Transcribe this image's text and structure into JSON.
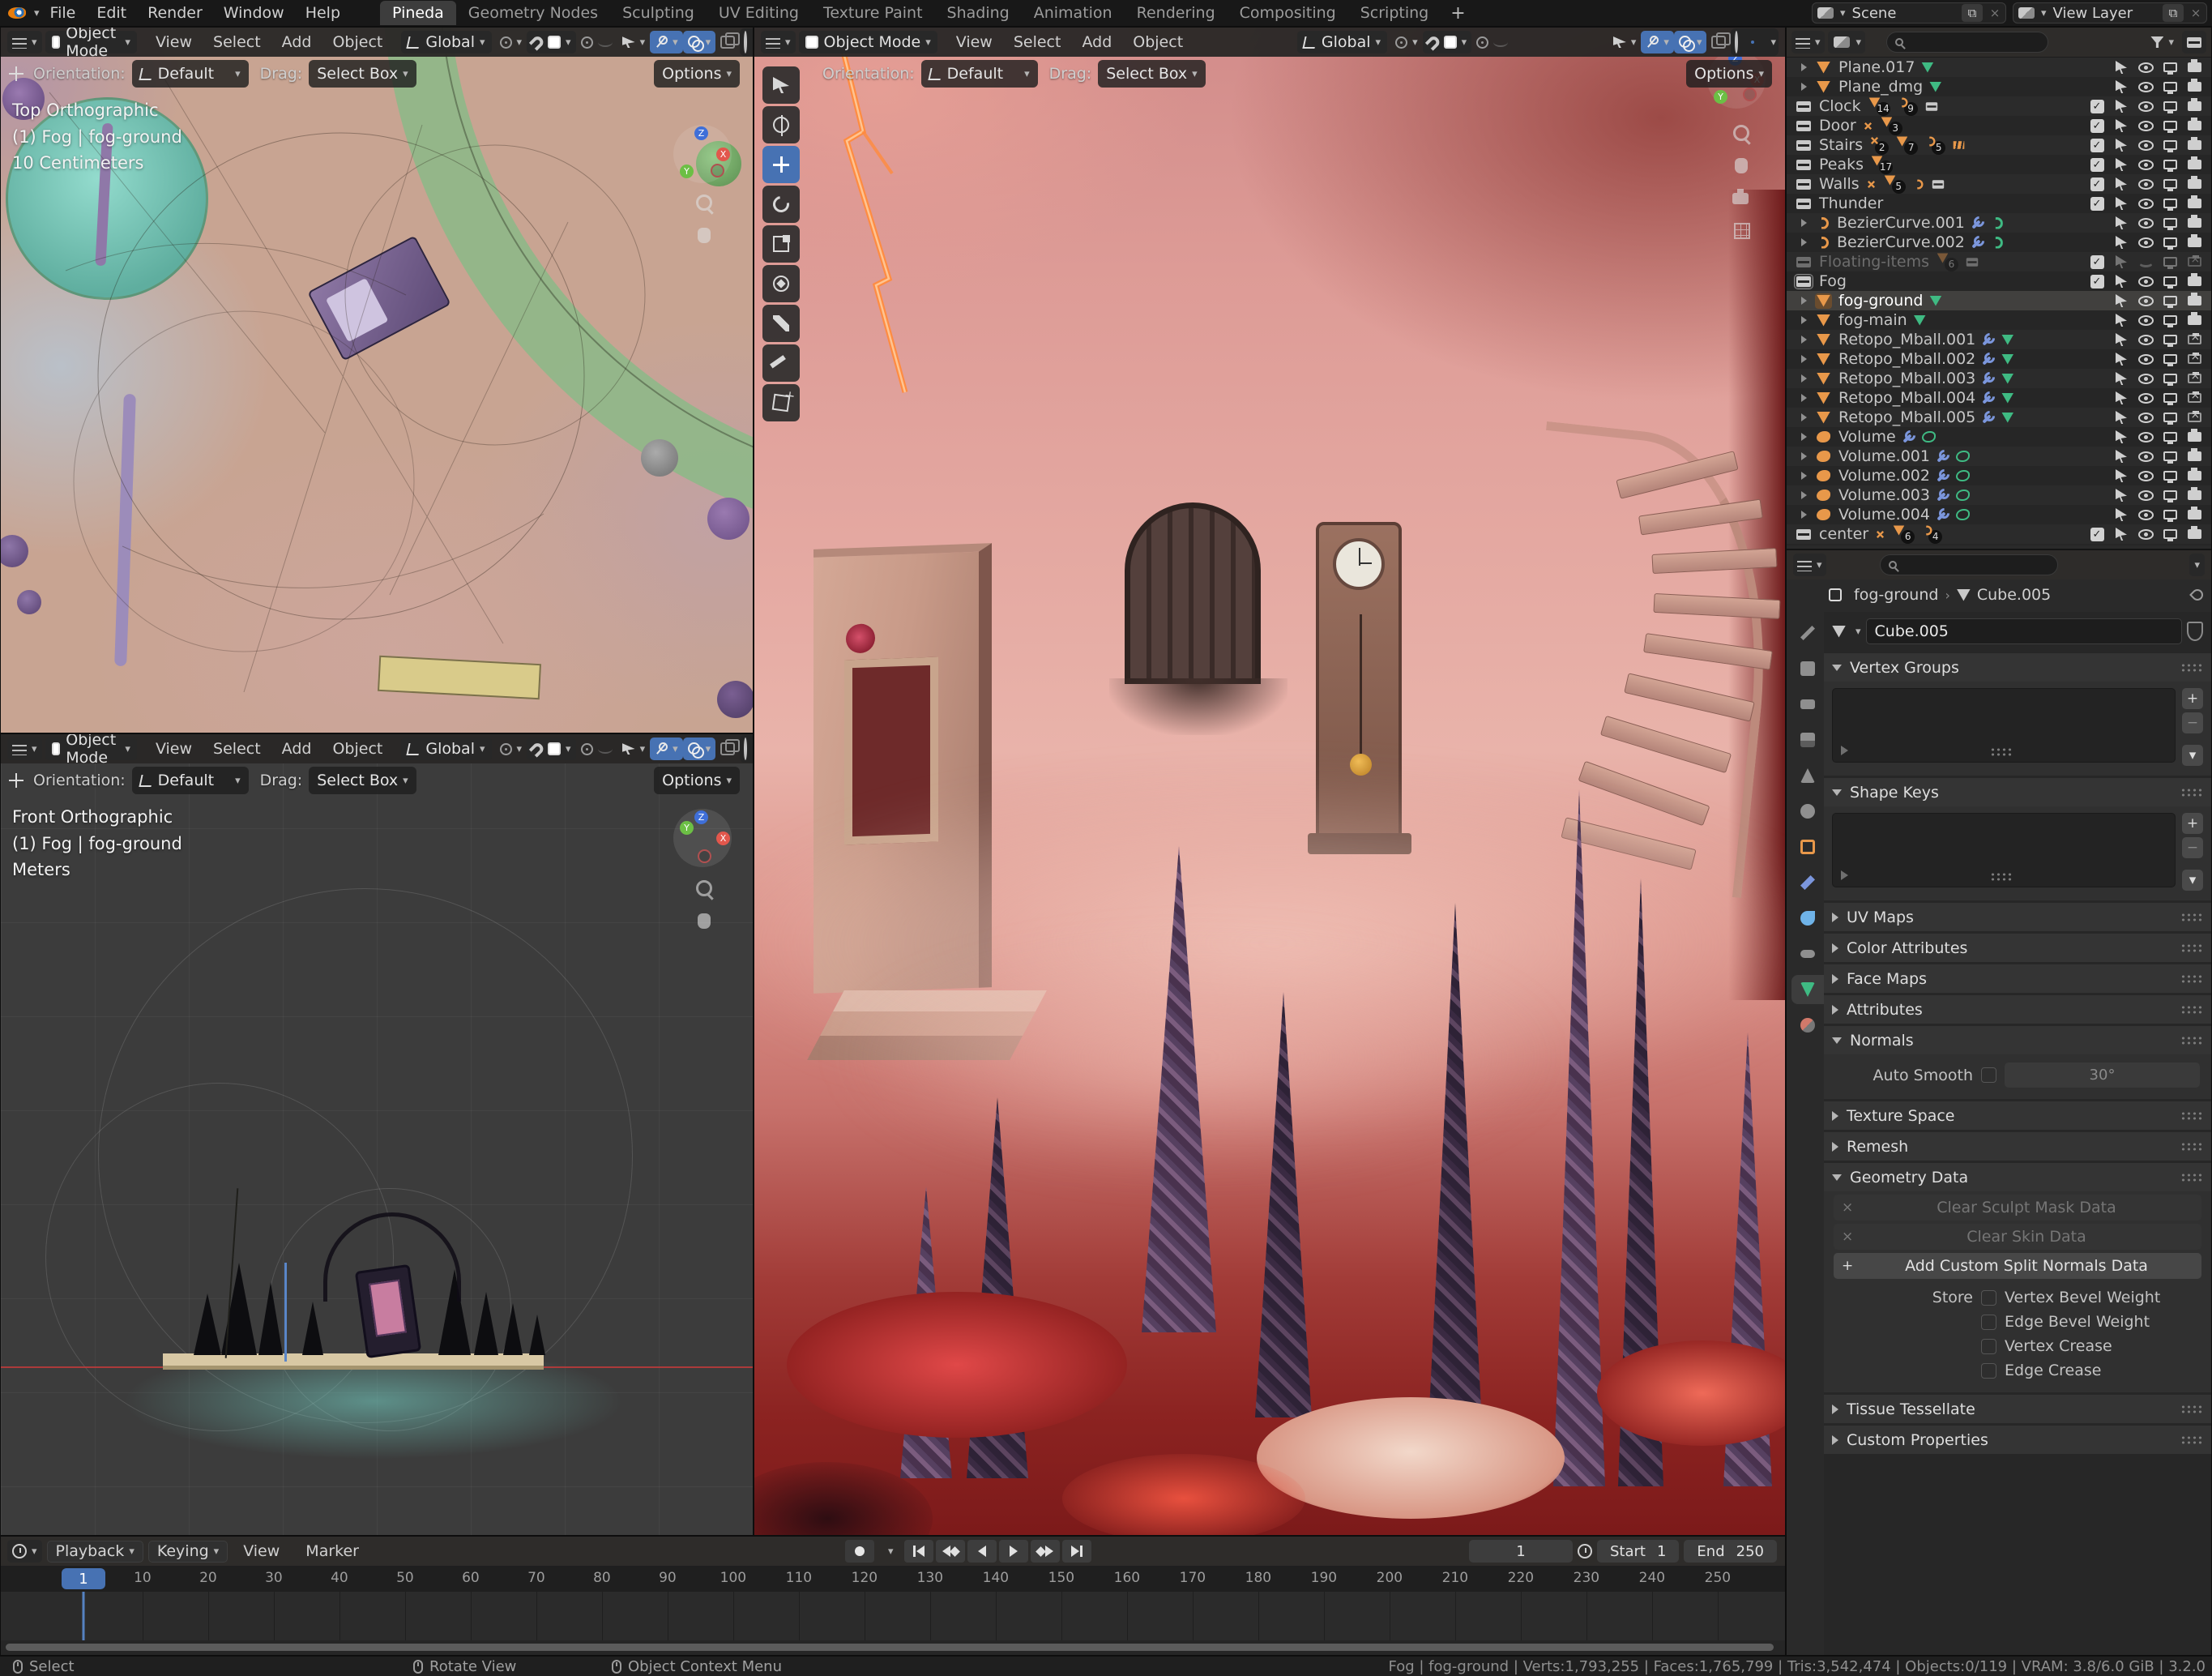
{
  "colors": {
    "accent_blue": "#4772b3",
    "mesh_orange": "#e8984a",
    "data_green": "#3fba83",
    "modifier_blue": "#7b96dc",
    "header_gray": "#2e2c2a",
    "render_pink": "#e4a8a1",
    "ground_red": "#7c1a1a",
    "playhead_blue": "#4772b3"
  },
  "topbar": {
    "menus": [
      "File",
      "Edit",
      "Render",
      "Window",
      "Help"
    ],
    "workspaces": [
      "Pineda",
      "Geometry Nodes",
      "Sculpting",
      "UV Editing",
      "Texture Paint",
      "Shading",
      "Animation",
      "Rendering",
      "Compositing",
      "Scripting"
    ],
    "active_workspace": "Pineda",
    "new_workspace_label": "+",
    "scene_name": "Scene",
    "view_layer_name": "View Layer"
  },
  "viewport_header": {
    "mode": "Object Mode",
    "menus": [
      "View",
      "Select",
      "Add",
      "Object"
    ],
    "transform_orientation": "Global",
    "orientation_label": "Orientation:",
    "orientation_value": "Default",
    "drag_label": "Drag:",
    "drag_value": "Select Box",
    "options_label": "Options"
  },
  "viewports": {
    "top": {
      "lines": [
        "Top Orthographic",
        "(1) Fog | fog-ground",
        "10 Centimeters"
      ]
    },
    "front": {
      "lines": [
        "Front Orthographic",
        "(1) Fog | fog-ground",
        "Meters"
      ]
    }
  },
  "main_toolbar": [
    {
      "name": "select-box"
    },
    {
      "name": "cursor"
    },
    {
      "name": "move",
      "active": true
    },
    {
      "name": "rotate"
    },
    {
      "name": "scale"
    },
    {
      "name": "transform"
    },
    {
      "name": "annotate"
    },
    {
      "name": "measure"
    },
    {
      "name": "add-primitive"
    }
  ],
  "outliner": {
    "search_placeholder": "",
    "rows": [
      {
        "label": "Plane.017",
        "icon": "mesh",
        "object": true,
        "data_icon": "mesh",
        "camera": "on"
      },
      {
        "label": "Plane_dmg",
        "icon": "mesh",
        "object": true,
        "data_icon": "mesh",
        "camera": "on"
      },
      {
        "label": "Clock",
        "icon": "collection",
        "checkbox": true,
        "counts": [
          {
            "icon": "mesh",
            "n": "14"
          },
          {
            "icon": "curve",
            "n": "9"
          },
          {
            "icon": "collection"
          }
        ],
        "camera": "on"
      },
      {
        "label": "Door",
        "icon": "collection",
        "checkbox": true,
        "counts": [
          {
            "icon": "empty"
          },
          {
            "icon": "mesh",
            "n": "3"
          }
        ],
        "camera": "on"
      },
      {
        "label": "Stairs",
        "icon": "collection",
        "checkbox": true,
        "counts": [
          {
            "icon": "empty",
            "n": "2"
          },
          {
            "icon": "mesh",
            "n": "7"
          },
          {
            "icon": "curve",
            "n": "5"
          },
          {
            "icon": "tiles"
          }
        ],
        "camera": "on"
      },
      {
        "label": "Peaks",
        "icon": "collection",
        "checkbox": true,
        "counts": [
          {
            "icon": "mesh",
            "n": "17"
          }
        ],
        "camera": "on"
      },
      {
        "label": "Walls",
        "icon": "collection",
        "checkbox": true,
        "counts": [
          {
            "icon": "empty"
          },
          {
            "icon": "mesh",
            "n": "5"
          },
          {
            "icon": "curve"
          },
          {
            "icon": "collection"
          }
        ],
        "camera": "on"
      },
      {
        "label": "Thunder",
        "icon": "collection",
        "checkbox": true,
        "camera": "on"
      },
      {
        "label": "BezierCurve.001",
        "icon": "curve",
        "object": true,
        "wrench": true,
        "data_icon": "curve",
        "camera": "on"
      },
      {
        "label": "BezierCurve.002",
        "icon": "curve",
        "object": true,
        "wrench": true,
        "data_icon": "curve",
        "camera": "on"
      },
      {
        "label": "Floating-items",
        "icon": "collection",
        "checkbox": true,
        "faded": true,
        "counts": [
          {
            "icon": "mesh",
            "n": "6"
          },
          {
            "icon": "collection"
          }
        ],
        "eye": "closed",
        "camera": "x"
      },
      {
        "label": "Fog",
        "icon": "collection",
        "checkbox": true,
        "active_collection": true,
        "camera": "on"
      },
      {
        "label": "fog-ground",
        "icon": "mesh",
        "object": true,
        "selected": true,
        "data_icon": "mesh",
        "camera": "on"
      },
      {
        "label": "fog-main",
        "icon": "mesh",
        "object": true,
        "data_icon": "mesh",
        "camera": "on"
      },
      {
        "label": "Retopo_Mball.001",
        "icon": "mesh",
        "object": true,
        "wrench": true,
        "data_icon": "mesh",
        "camera": "x"
      },
      {
        "label": "Retopo_Mball.002",
        "icon": "mesh",
        "object": true,
        "wrench": true,
        "data_icon": "mesh",
        "camera": "x"
      },
      {
        "label": "Retopo_Mball.003",
        "icon": "mesh",
        "object": true,
        "wrench": true,
        "data_icon": "mesh",
        "camera": "x"
      },
      {
        "label": "Retopo_Mball.004",
        "icon": "mesh",
        "object": true,
        "wrench": true,
        "data_icon": "mesh",
        "camera": "x"
      },
      {
        "label": "Retopo_Mball.005",
        "icon": "mesh",
        "object": true,
        "wrench": true,
        "data_icon": "mesh",
        "camera": "x"
      },
      {
        "label": "Volume",
        "icon": "volume",
        "object": true,
        "wrench": true,
        "data_icon": "volume",
        "camera": "on"
      },
      {
        "label": "Volume.001",
        "icon": "volume",
        "object": true,
        "wrench": true,
        "data_icon": "volume",
        "camera": "on"
      },
      {
        "label": "Volume.002",
        "icon": "volume",
        "object": true,
        "wrench": true,
        "data_icon": "volume",
        "camera": "on"
      },
      {
        "label": "Volume.003",
        "icon": "volume",
        "object": true,
        "wrench": true,
        "data_icon": "volume",
        "camera": "on"
      },
      {
        "label": "Volume.004",
        "icon": "volume",
        "object": true,
        "wrench": true,
        "data_icon": "volume",
        "camera": "on"
      },
      {
        "label": "center",
        "icon": "collection",
        "checkbox": true,
        "counts": [
          {
            "icon": "empty"
          },
          {
            "icon": "mesh",
            "n": "6"
          },
          {
            "icon": "curve",
            "n": "4"
          }
        ],
        "camera": "on"
      }
    ]
  },
  "properties": {
    "search_placeholder": "",
    "breadcrumb": {
      "object": "fog-ground",
      "data": "Cube.005"
    },
    "name_value": "Cube.005",
    "tabs": [
      {
        "name": "tool"
      },
      {
        "name": "render"
      },
      {
        "name": "output"
      },
      {
        "name": "view-layer"
      },
      {
        "name": "scene"
      },
      {
        "name": "world"
      },
      {
        "name": "object"
      },
      {
        "name": "modifiers"
      },
      {
        "name": "physics"
      },
      {
        "name": "constraints"
      },
      {
        "name": "object-data",
        "active": true
      },
      {
        "name": "material"
      }
    ],
    "panels": [
      {
        "label": "Vertex Groups"
      },
      {
        "label": "Shape Keys"
      },
      {
        "label": "UV Maps"
      },
      {
        "label": "Color Attributes"
      },
      {
        "label": "Face Maps"
      },
      {
        "label": "Attributes"
      },
      {
        "label": "Normals"
      },
      {
        "label": "Texture Space"
      },
      {
        "label": "Remesh"
      },
      {
        "label": "Geometry Data"
      },
      {
        "label": "Tissue Tessellate"
      },
      {
        "label": "Custom Properties"
      }
    ],
    "normals": {
      "auto_smooth_label": "Auto Smooth",
      "angle_value": "30°"
    },
    "geometry": {
      "clear_sculpt": "Clear Sculpt Mask Data",
      "clear_skin": "Clear Skin Data",
      "add_split": "Add Custom Split Normals Data",
      "store_label": "Store",
      "options": [
        "Vertex Bevel Weight",
        "Edge Bevel Weight",
        "Vertex Crease",
        "Edge Crease"
      ]
    }
  },
  "timeline": {
    "menus": [
      "Playback",
      "Keying",
      "View",
      "Marker"
    ],
    "tick_start": 10,
    "tick_end": 250,
    "tick_step": 10,
    "current_frame": "1",
    "start_label": "Start",
    "start_value": "1",
    "end_label": "End",
    "end_value": "250"
  },
  "statusbar": {
    "hints": [
      "Select",
      "Rotate View",
      "Object Context Menu"
    ],
    "info": "Fog | fog-ground | Verts:1,793,255 | Faces:1,765,799 | Tris:3,542,474 | Objects:0/119 | VRAM: 3.8/6.0 GiB | 3.2.0"
  }
}
